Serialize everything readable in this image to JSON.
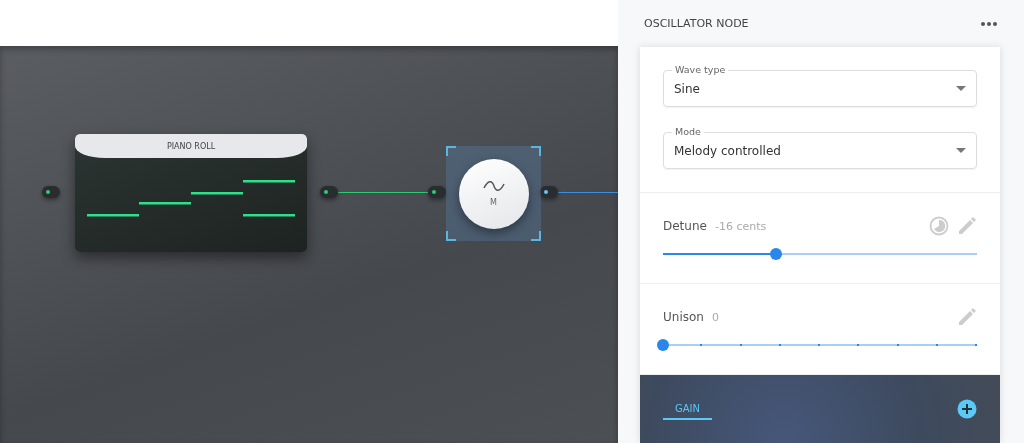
{
  "canvas": {
    "nodes": [
      {
        "kind": "piano_roll",
        "title": "PIANO ROLL"
      },
      {
        "kind": "oscillator",
        "label": "M",
        "selected": true
      }
    ],
    "connections": [
      {
        "color": "#2ecc71"
      },
      {
        "color": "#3b8fe0"
      }
    ]
  },
  "panel": {
    "title": "OSCILLATOR NODE",
    "fields": [
      {
        "label": "Wave type",
        "value": "Sine"
      },
      {
        "label": "Mode",
        "value": "Melody controlled"
      }
    ],
    "sliders": [
      {
        "kind": "continuous",
        "label": "Detune",
        "reading": "-16 cents",
        "level": 0.36,
        "modulated": true
      },
      {
        "kind": "stepped",
        "label": "Unison",
        "reading": "0",
        "level": 0,
        "modulated": false
      }
    ],
    "tabs": [
      {
        "label": "GAIN",
        "selected": true
      }
    ]
  }
}
